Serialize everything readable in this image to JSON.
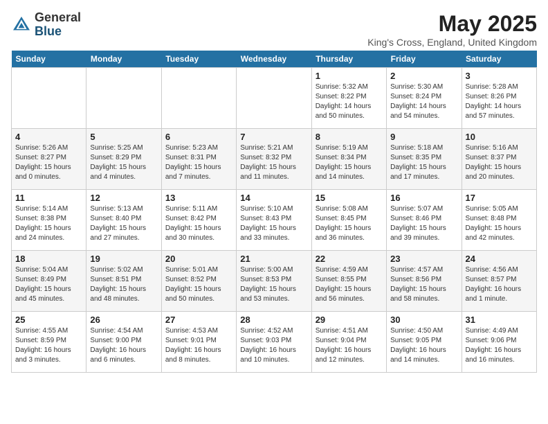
{
  "header": {
    "logo_line1": "General",
    "logo_line2": "Blue",
    "month": "May 2025",
    "location": "King's Cross, England, United Kingdom"
  },
  "weekdays": [
    "Sunday",
    "Monday",
    "Tuesday",
    "Wednesday",
    "Thursday",
    "Friday",
    "Saturday"
  ],
  "weeks": [
    [
      {
        "day": "",
        "info": ""
      },
      {
        "day": "",
        "info": ""
      },
      {
        "day": "",
        "info": ""
      },
      {
        "day": "",
        "info": ""
      },
      {
        "day": "1",
        "info": "Sunrise: 5:32 AM\nSunset: 8:22 PM\nDaylight: 14 hours\nand 50 minutes."
      },
      {
        "day": "2",
        "info": "Sunrise: 5:30 AM\nSunset: 8:24 PM\nDaylight: 14 hours\nand 54 minutes."
      },
      {
        "day": "3",
        "info": "Sunrise: 5:28 AM\nSunset: 8:26 PM\nDaylight: 14 hours\nand 57 minutes."
      }
    ],
    [
      {
        "day": "4",
        "info": "Sunrise: 5:26 AM\nSunset: 8:27 PM\nDaylight: 15 hours\nand 0 minutes."
      },
      {
        "day": "5",
        "info": "Sunrise: 5:25 AM\nSunset: 8:29 PM\nDaylight: 15 hours\nand 4 minutes."
      },
      {
        "day": "6",
        "info": "Sunrise: 5:23 AM\nSunset: 8:31 PM\nDaylight: 15 hours\nand 7 minutes."
      },
      {
        "day": "7",
        "info": "Sunrise: 5:21 AM\nSunset: 8:32 PM\nDaylight: 15 hours\nand 11 minutes."
      },
      {
        "day": "8",
        "info": "Sunrise: 5:19 AM\nSunset: 8:34 PM\nDaylight: 15 hours\nand 14 minutes."
      },
      {
        "day": "9",
        "info": "Sunrise: 5:18 AM\nSunset: 8:35 PM\nDaylight: 15 hours\nand 17 minutes."
      },
      {
        "day": "10",
        "info": "Sunrise: 5:16 AM\nSunset: 8:37 PM\nDaylight: 15 hours\nand 20 minutes."
      }
    ],
    [
      {
        "day": "11",
        "info": "Sunrise: 5:14 AM\nSunset: 8:38 PM\nDaylight: 15 hours\nand 24 minutes."
      },
      {
        "day": "12",
        "info": "Sunrise: 5:13 AM\nSunset: 8:40 PM\nDaylight: 15 hours\nand 27 minutes."
      },
      {
        "day": "13",
        "info": "Sunrise: 5:11 AM\nSunset: 8:42 PM\nDaylight: 15 hours\nand 30 minutes."
      },
      {
        "day": "14",
        "info": "Sunrise: 5:10 AM\nSunset: 8:43 PM\nDaylight: 15 hours\nand 33 minutes."
      },
      {
        "day": "15",
        "info": "Sunrise: 5:08 AM\nSunset: 8:45 PM\nDaylight: 15 hours\nand 36 minutes."
      },
      {
        "day": "16",
        "info": "Sunrise: 5:07 AM\nSunset: 8:46 PM\nDaylight: 15 hours\nand 39 minutes."
      },
      {
        "day": "17",
        "info": "Sunrise: 5:05 AM\nSunset: 8:48 PM\nDaylight: 15 hours\nand 42 minutes."
      }
    ],
    [
      {
        "day": "18",
        "info": "Sunrise: 5:04 AM\nSunset: 8:49 PM\nDaylight: 15 hours\nand 45 minutes."
      },
      {
        "day": "19",
        "info": "Sunrise: 5:02 AM\nSunset: 8:51 PM\nDaylight: 15 hours\nand 48 minutes."
      },
      {
        "day": "20",
        "info": "Sunrise: 5:01 AM\nSunset: 8:52 PM\nDaylight: 15 hours\nand 50 minutes."
      },
      {
        "day": "21",
        "info": "Sunrise: 5:00 AM\nSunset: 8:53 PM\nDaylight: 15 hours\nand 53 minutes."
      },
      {
        "day": "22",
        "info": "Sunrise: 4:59 AM\nSunset: 8:55 PM\nDaylight: 15 hours\nand 56 minutes."
      },
      {
        "day": "23",
        "info": "Sunrise: 4:57 AM\nSunset: 8:56 PM\nDaylight: 15 hours\nand 58 minutes."
      },
      {
        "day": "24",
        "info": "Sunrise: 4:56 AM\nSunset: 8:57 PM\nDaylight: 16 hours\nand 1 minute."
      }
    ],
    [
      {
        "day": "25",
        "info": "Sunrise: 4:55 AM\nSunset: 8:59 PM\nDaylight: 16 hours\nand 3 minutes."
      },
      {
        "day": "26",
        "info": "Sunrise: 4:54 AM\nSunset: 9:00 PM\nDaylight: 16 hours\nand 6 minutes."
      },
      {
        "day": "27",
        "info": "Sunrise: 4:53 AM\nSunset: 9:01 PM\nDaylight: 16 hours\nand 8 minutes."
      },
      {
        "day": "28",
        "info": "Sunrise: 4:52 AM\nSunset: 9:03 PM\nDaylight: 16 hours\nand 10 minutes."
      },
      {
        "day": "29",
        "info": "Sunrise: 4:51 AM\nSunset: 9:04 PM\nDaylight: 16 hours\nand 12 minutes."
      },
      {
        "day": "30",
        "info": "Sunrise: 4:50 AM\nSunset: 9:05 PM\nDaylight: 16 hours\nand 14 minutes."
      },
      {
        "day": "31",
        "info": "Sunrise: 4:49 AM\nSunset: 9:06 PM\nDaylight: 16 hours\nand 16 minutes."
      }
    ]
  ]
}
